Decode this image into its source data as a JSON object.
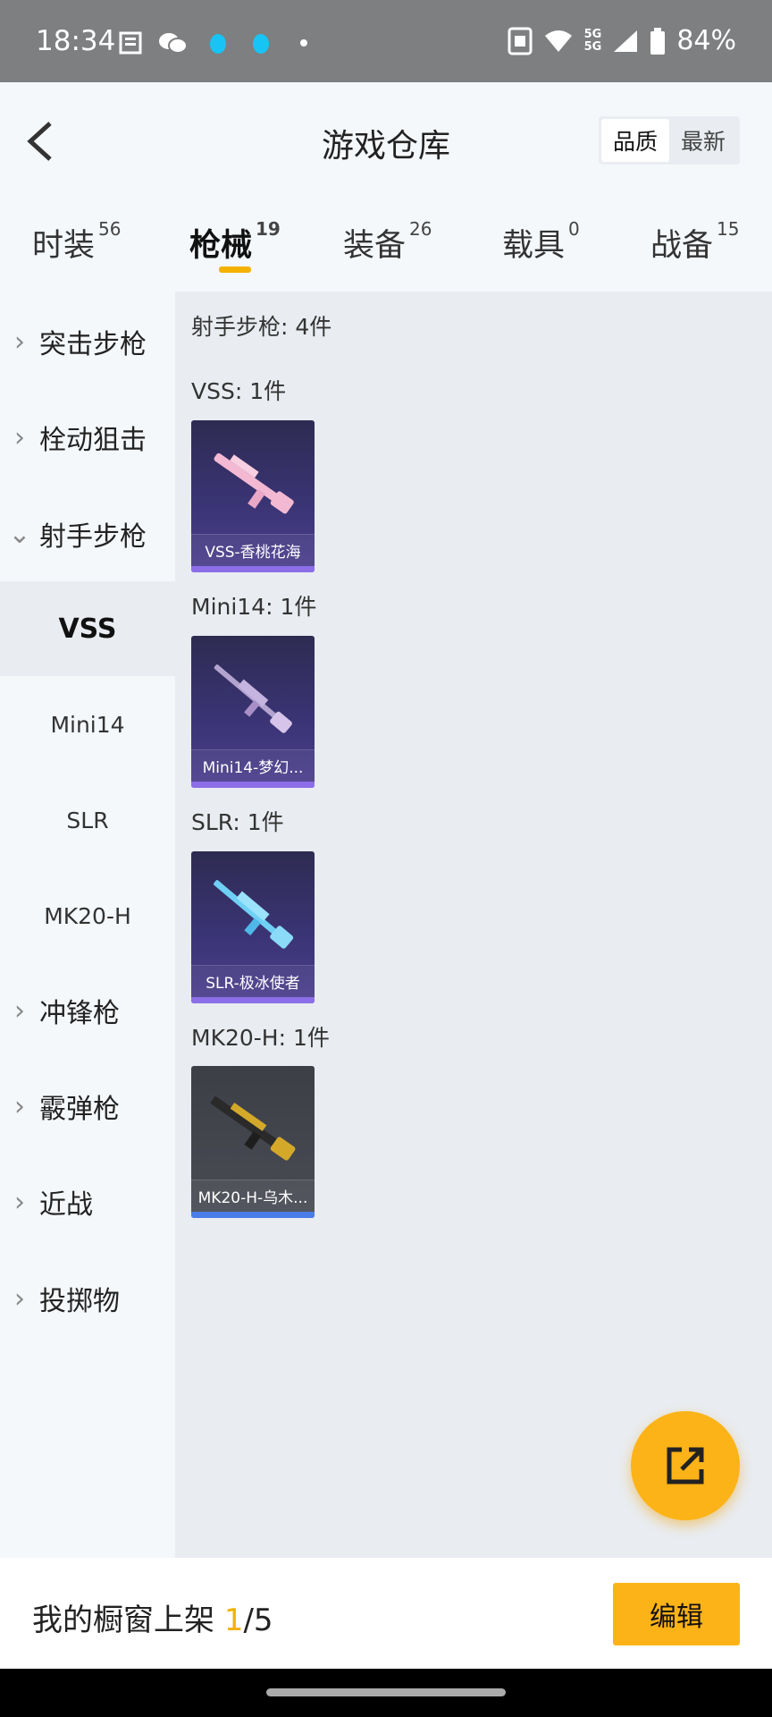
{
  "status_bar": {
    "time": "18:34",
    "battery": "84%",
    "network_top": "5G",
    "network_bottom": "5G",
    "icons": [
      "notebook-icon",
      "wechat-icon",
      "drop-icon",
      "drop-icon",
      "dot-icon",
      "sim-card-icon",
      "wifi-icon",
      "signal-icon",
      "battery-icon"
    ]
  },
  "header": {
    "title": "游戏仓库",
    "sort_options": [
      "品质",
      "最新"
    ],
    "active_sort": "品质"
  },
  "tabs": [
    {
      "label": "时装",
      "count": "56"
    },
    {
      "label": "枪械",
      "count": "19"
    },
    {
      "label": "装备",
      "count": "26"
    },
    {
      "label": "载具",
      "count": "0"
    },
    {
      "label": "战备",
      "count": "15"
    }
  ],
  "sidebar": {
    "categories": [
      "突击步枪",
      "栓动狙击",
      "射手步枪",
      "冲锋枪",
      "霰弹枪",
      "近战",
      "投掷物"
    ],
    "subcategories": [
      "VSS",
      "Mini14",
      "SLR",
      "MK20-H"
    ]
  },
  "content": {
    "heading": "射手步枪: 4件",
    "groups": [
      {
        "label": "VSS: 1件",
        "item": "VSS-香桃花海",
        "quality": "purple"
      },
      {
        "label": "Mini14: 1件",
        "item": "Mini14-梦幻...",
        "quality": "purple"
      },
      {
        "label": "SLR: 1件",
        "item": "SLR-极冰使者",
        "quality": "purple"
      },
      {
        "label": "MK20-H: 1件",
        "item": "MK20-H-乌木...",
        "quality": "blue"
      }
    ]
  },
  "bottom_bar": {
    "label": "我的橱窗上架",
    "current": "1",
    "total": "/5",
    "edit_label": "编辑"
  },
  "colors": {
    "accent": "#fcb317",
    "purple_quality": "#8b6ee8",
    "blue_quality": "#4a7de8"
  }
}
